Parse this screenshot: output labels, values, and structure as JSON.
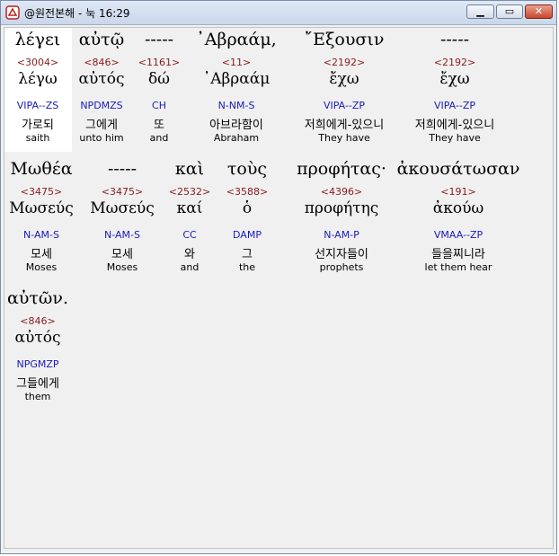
{
  "window": {
    "title": "@원전본해 - 눅 16:29",
    "app_icon": "bible-icon",
    "buttons": {
      "minimize": "minimize-icon",
      "maximize": "maximize-icon",
      "close": "close-icon"
    }
  },
  "colors": {
    "strongs_number": "#8b1a1a",
    "morphology": "#1a1ab8",
    "selection_background": "#ffffff",
    "client_background": "#f0f0f0"
  },
  "words": [
    {
      "greek": "λέγει",
      "strongs": "<3004>",
      "lemma": "λέγω",
      "morph": "VIPA--ZS",
      "korean": "가로되",
      "english": "saith"
    },
    {
      "greek": "αὐτῷ",
      "strongs": "<846>",
      "lemma": "αὐτός",
      "morph": "NPDMZS",
      "korean": "그에게",
      "english": "unto him"
    },
    {
      "greek": "-----",
      "strongs": "<1161>",
      "lemma": "δώ",
      "morph": "CH",
      "korean": "또",
      "english": "and"
    },
    {
      "greek": "᾿Αβραάμ,",
      "strongs": "<11>",
      "lemma": "᾿Αβραάμ",
      "morph": "N-NM-S",
      "korean": "아브라함이",
      "english": "Abraham"
    },
    {
      "greek": "῎Εξουσιν",
      "strongs": "<2192>",
      "lemma": "ἔχω",
      "morph": "VIPA--ZP",
      "korean": "저희에게-있으니",
      "english": "They have"
    },
    {
      "greek": "-----",
      "strongs": "<2192>",
      "lemma": "ἔχω",
      "morph": "VIPA--ZP",
      "korean": "저희에게-있으니",
      "english": "They have"
    },
    {
      "greek": "Μωθέα",
      "strongs": "<3475>",
      "lemma": "Μωσεύς",
      "morph": "N-AM-S",
      "korean": "모세",
      "english": "Moses"
    },
    {
      "greek": "-----",
      "strongs": "<3475>",
      "lemma": "Μωσεύς",
      "morph": "N-AM-S",
      "korean": "모세",
      "english": "Moses"
    },
    {
      "greek": "καὶ",
      "strongs": "<2532>",
      "lemma": "καί",
      "morph": "CC",
      "korean": "와",
      "english": "and"
    },
    {
      "greek": "τοὺς",
      "strongs": "<3588>",
      "lemma": "ὁ",
      "morph": "DAMP",
      "korean": "그",
      "english": "the"
    },
    {
      "greek": "προφήτας·",
      "strongs": "<4396>",
      "lemma": "προφήτης",
      "morph": "N-AM-P",
      "korean": "선지자들이",
      "english": "prophets"
    },
    {
      "greek": "ἀκουσάτωσαν",
      "strongs": "<191>",
      "lemma": "ἀκούω",
      "morph": "VMAA--ZP",
      "korean": "들을찌니라",
      "english": "let them hear"
    },
    {
      "greek": "αὐτῶν.",
      "strongs": "<846>",
      "lemma": "αὐτός",
      "morph": "NPGMZP",
      "korean": "그들에게",
      "english": "them"
    }
  ]
}
